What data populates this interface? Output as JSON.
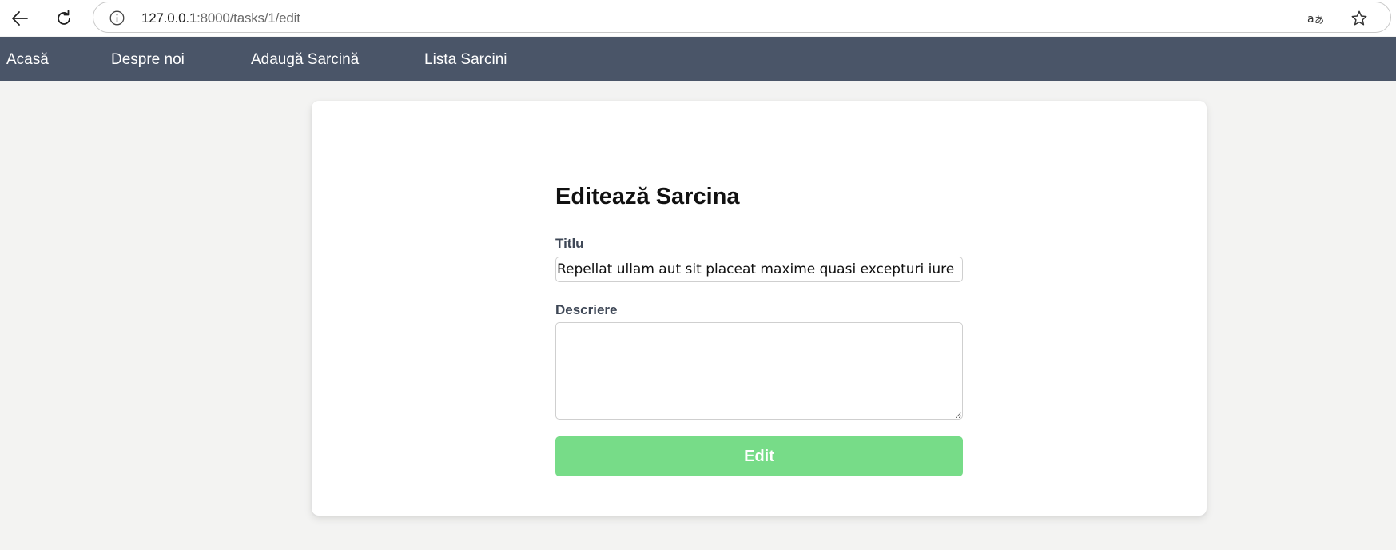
{
  "browser": {
    "url_host": "127.0.0.1",
    "url_path": ":8000/tasks/1/edit",
    "icons": [
      "back-arrow-icon",
      "reload-icon",
      "info-icon",
      "translate-icon",
      "star-icon"
    ]
  },
  "nav": {
    "items": [
      {
        "label": "Acasă"
      },
      {
        "label": "Despre noi"
      },
      {
        "label": "Adaugă Sarcină"
      },
      {
        "label": "Lista Sarcini"
      }
    ]
  },
  "form": {
    "title": "Editează Sarcina",
    "title_label": "Titlu",
    "title_value": "Repellat ullam aut sit placeat maxime quasi excepturi iure",
    "description_label": "Descriere",
    "description_value": "",
    "submit_label": "Edit"
  },
  "colors": {
    "navbar": "#4a5568",
    "submit_button": "#77dc88",
    "page_background": "#f3f3f2"
  }
}
